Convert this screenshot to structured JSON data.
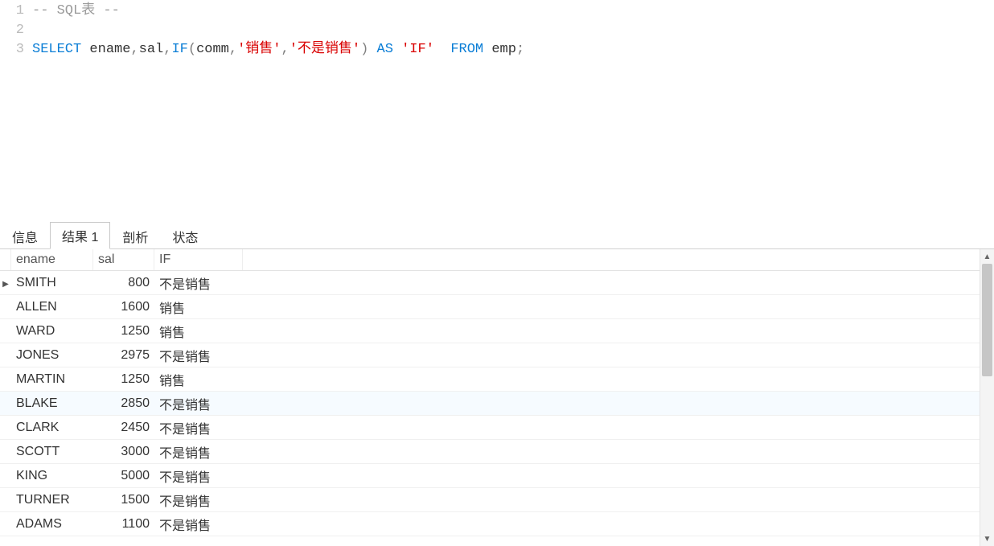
{
  "editor": {
    "lines": [
      {
        "num": "1",
        "tokens": [
          {
            "cls": "c-comment",
            "t": "-- SQL表 --"
          }
        ]
      },
      {
        "num": "2",
        "tokens": []
      },
      {
        "num": "3",
        "tokens": [
          {
            "cls": "c-kw",
            "t": "SELECT"
          },
          {
            "cls": "c-id",
            "t": " ename"
          },
          {
            "cls": "c-punc",
            "t": ","
          },
          {
            "cls": "c-id",
            "t": "sal"
          },
          {
            "cls": "c-punc",
            "t": ","
          },
          {
            "cls": "c-func",
            "t": "IF"
          },
          {
            "cls": "c-punc",
            "t": "("
          },
          {
            "cls": "c-id",
            "t": "comm"
          },
          {
            "cls": "c-punc",
            "t": ","
          },
          {
            "cls": "c-str",
            "t": "'销售'"
          },
          {
            "cls": "c-punc",
            "t": ","
          },
          {
            "cls": "c-str",
            "t": "'不是销售'"
          },
          {
            "cls": "c-punc",
            "t": ")"
          },
          {
            "cls": "c-id",
            "t": " "
          },
          {
            "cls": "c-kw",
            "t": "AS"
          },
          {
            "cls": "c-id",
            "t": " "
          },
          {
            "cls": "c-str",
            "t": "'IF'"
          },
          {
            "cls": "c-id",
            "t": " "
          },
          {
            "cls": "c-kw",
            "t": " FROM"
          },
          {
            "cls": "c-id",
            "t": " emp"
          },
          {
            "cls": "c-punc",
            "t": ";"
          }
        ]
      }
    ]
  },
  "tabs": {
    "items": [
      {
        "label": "信息",
        "active": false
      },
      {
        "label": "结果 1",
        "active": true
      },
      {
        "label": "剖析",
        "active": false
      },
      {
        "label": "状态",
        "active": false
      }
    ]
  },
  "grid": {
    "columns": [
      {
        "key": "ename",
        "label": "ename"
      },
      {
        "key": "sal",
        "label": "sal"
      },
      {
        "key": "if",
        "label": "IF"
      }
    ],
    "rows": [
      {
        "ename": "SMITH",
        "sal": "800",
        "if": "不是销售",
        "current": true
      },
      {
        "ename": "ALLEN",
        "sal": "1600",
        "if": "销售"
      },
      {
        "ename": "WARD",
        "sal": "1250",
        "if": "销售"
      },
      {
        "ename": "JONES",
        "sal": "2975",
        "if": "不是销售"
      },
      {
        "ename": "MARTIN",
        "sal": "1250",
        "if": "销售"
      },
      {
        "ename": "BLAKE",
        "sal": "2850",
        "if": "不是销售",
        "hover": true
      },
      {
        "ename": "CLARK",
        "sal": "2450",
        "if": "不是销售"
      },
      {
        "ename": "SCOTT",
        "sal": "3000",
        "if": "不是销售"
      },
      {
        "ename": "KING",
        "sal": "5000",
        "if": "不是销售"
      },
      {
        "ename": "TURNER",
        "sal": "1500",
        "if": "不是销售"
      },
      {
        "ename": "ADAMS",
        "sal": "1100",
        "if": "不是销售"
      }
    ]
  }
}
